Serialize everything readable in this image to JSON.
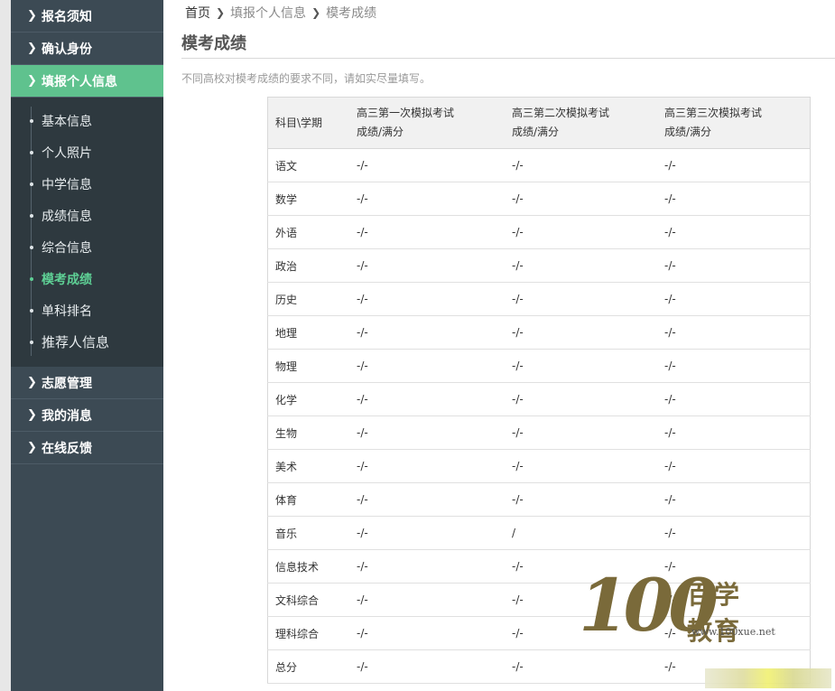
{
  "sidebar": {
    "top_items": [
      {
        "label": "报名须知"
      },
      {
        "label": "确认身份"
      },
      {
        "label": "填报个人信息"
      }
    ],
    "sub_items": [
      {
        "label": "基本信息"
      },
      {
        "label": "个人照片"
      },
      {
        "label": "中学信息"
      },
      {
        "label": "成绩信息"
      },
      {
        "label": "综合信息"
      },
      {
        "label": "模考成绩"
      },
      {
        "label": "单科排名"
      },
      {
        "label": "推荐人信息"
      }
    ],
    "bottom_items": [
      {
        "label": "志愿管理"
      },
      {
        "label": "我的消息"
      },
      {
        "label": "在线反馈"
      }
    ]
  },
  "breadcrumb": {
    "home": "首页",
    "level1": "填报个人信息",
    "level2": "模考成绩"
  },
  "page_title": "模考成绩",
  "note": "不同高校对模考成绩的要求不同，请如实尽量填写。",
  "table": {
    "headers": [
      {
        "line1": "科目\\学期",
        "line2": ""
      },
      {
        "line1": "高三第一次模拟考试",
        "line2": "成绩/满分"
      },
      {
        "line1": "高三第二次模拟考试",
        "line2": "成绩/满分"
      },
      {
        "line1": "高三第三次模拟考试",
        "line2": "成绩/满分"
      }
    ],
    "rows": [
      [
        "语文",
        "-/-",
        "-/-",
        "-/-"
      ],
      [
        "数学",
        "-/-",
        "-/-",
        "-/-"
      ],
      [
        "外语",
        "-/-",
        "-/-",
        "-/-"
      ],
      [
        "政治",
        "-/-",
        "-/-",
        "-/-"
      ],
      [
        "历史",
        "-/-",
        "-/-",
        "-/-"
      ],
      [
        "地理",
        "-/-",
        "-/-",
        "-/-"
      ],
      [
        "物理",
        "-/-",
        "-/-",
        "-/-"
      ],
      [
        "化学",
        "-/-",
        "-/-",
        "-/-"
      ],
      [
        "生物",
        "-/-",
        "-/-",
        "-/-"
      ],
      [
        "美术",
        "-/-",
        "-/-",
        "-/-"
      ],
      [
        "体育",
        "-/-",
        "-/-",
        "-/-"
      ],
      [
        "音乐",
        "-/-",
        "/",
        "-/-"
      ],
      [
        "信息技术",
        "-/-",
        "-/-",
        "-/-"
      ],
      [
        "文科综合",
        "-/-",
        "-/-",
        "-/-"
      ],
      [
        "理科综合",
        "-/-",
        "-/-",
        "-/-"
      ],
      [
        "总分",
        "-/-",
        "-/-",
        "-/-"
      ]
    ]
  },
  "watermark": {
    "digits": "100",
    "brand": "百学教育",
    "url": "www.100xue.net"
  },
  "colors": {
    "sidebar_bg": "#3c4a54",
    "active_bg": "#5fc28e",
    "current_sub": "#5ed095"
  },
  "icons": {
    "nav_chevron": "chevron-right-icon",
    "breadcrumb_sep": "chevron-right-icon"
  }
}
